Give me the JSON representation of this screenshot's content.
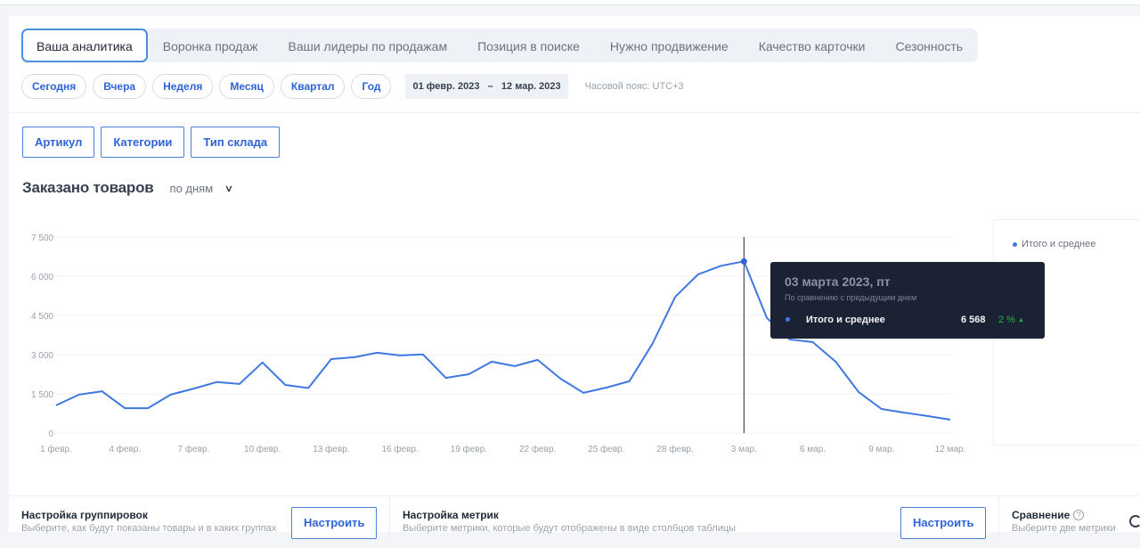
{
  "tabs": [
    {
      "label": "Ваша аналитика",
      "active": true
    },
    {
      "label": "Воронка продаж",
      "active": false
    },
    {
      "label": "Ваши лидеры по продажам",
      "active": false
    },
    {
      "label": "Позиция в поиске",
      "active": false
    },
    {
      "label": "Нужно продвижение",
      "active": false
    },
    {
      "label": "Качество карточки",
      "active": false
    },
    {
      "label": "Сезонность",
      "active": false
    }
  ],
  "periods": [
    "Сегодня",
    "Вчера",
    "Неделя",
    "Месяц",
    "Квартал",
    "Год"
  ],
  "date_range": {
    "from": "01 февр. 2023",
    "separator": "–",
    "to": "12 мар. 2023"
  },
  "timezone": "Часовой пояс: UTC+3",
  "group_buttons": [
    "Артикул",
    "Категории",
    "Тип склада"
  ],
  "chart_header": {
    "title": "Заказано товаров",
    "granularity": "по дням",
    "chevron_icon": "chevron-down-icon"
  },
  "legend": {
    "items": [
      {
        "label": "Итого и среднее",
        "color": "#3f78e0"
      }
    ]
  },
  "tooltip": {
    "date": "03 марта 2023, пт",
    "subtitle": "По сравнению с предыдущим днем",
    "series": "Итого и среднее",
    "value": "6 568",
    "change": "2 %",
    "change_icon": "▲",
    "change_color": "#1fb84a"
  },
  "bottom": {
    "grouping": {
      "title": "Настройка группировок",
      "desc": "Выберите, как будут показаны товары и в каких группах",
      "button": "Настроить"
    },
    "metrics": {
      "title": "Настройка метрик",
      "desc": "Выберите метрики, которые будут отображены в виде столбцов таблицы",
      "button": "Настроить"
    },
    "compare": {
      "title": "Сравнение",
      "desc": "Выберите две метрики",
      "help_icon": "?"
    }
  },
  "colors": {
    "accent": "#2e63d9",
    "line": "#3f78e0",
    "tooltip_bg": "#1b2233"
  },
  "chart_data": {
    "type": "line",
    "title": "Заказано товаров",
    "xlabel": "",
    "ylabel": "",
    "ylim": [
      0,
      7500
    ],
    "yticks": [
      0,
      1500,
      3000,
      4500,
      6000,
      7500
    ],
    "ytick_labels": [
      "0",
      "1 500",
      "3 000",
      "4 500",
      "6 000",
      "7 500"
    ],
    "xtick_indices": [
      0,
      3,
      6,
      9,
      12,
      15,
      18,
      21,
      24,
      27,
      30,
      33,
      36,
      39
    ],
    "xtick_labels": [
      "1 февр.",
      "4 февр.",
      "7 февр.",
      "10 февр.",
      "13 февр.",
      "16 февр.",
      "19 февр.",
      "22 февр.",
      "25 февр.",
      "28 февр.",
      "3 мар.",
      "6 мар.",
      "9 мар.",
      "12 мар."
    ],
    "grid": true,
    "legend_position": "right",
    "highlight_index": 30,
    "series": [
      {
        "name": "Итого и среднее",
        "values": [
          1060,
          1470,
          1600,
          950,
          950,
          1470,
          1700,
          1950,
          1880,
          2700,
          1840,
          1720,
          2830,
          2900,
          3070,
          2970,
          3010,
          2110,
          2250,
          2730,
          2560,
          2800,
          2080,
          1540,
          1740,
          1980,
          3400,
          5210,
          6070,
          6400,
          6568,
          4400,
          3580,
          3480,
          2730,
          1570,
          920,
          780,
          650,
          510
        ]
      }
    ]
  }
}
